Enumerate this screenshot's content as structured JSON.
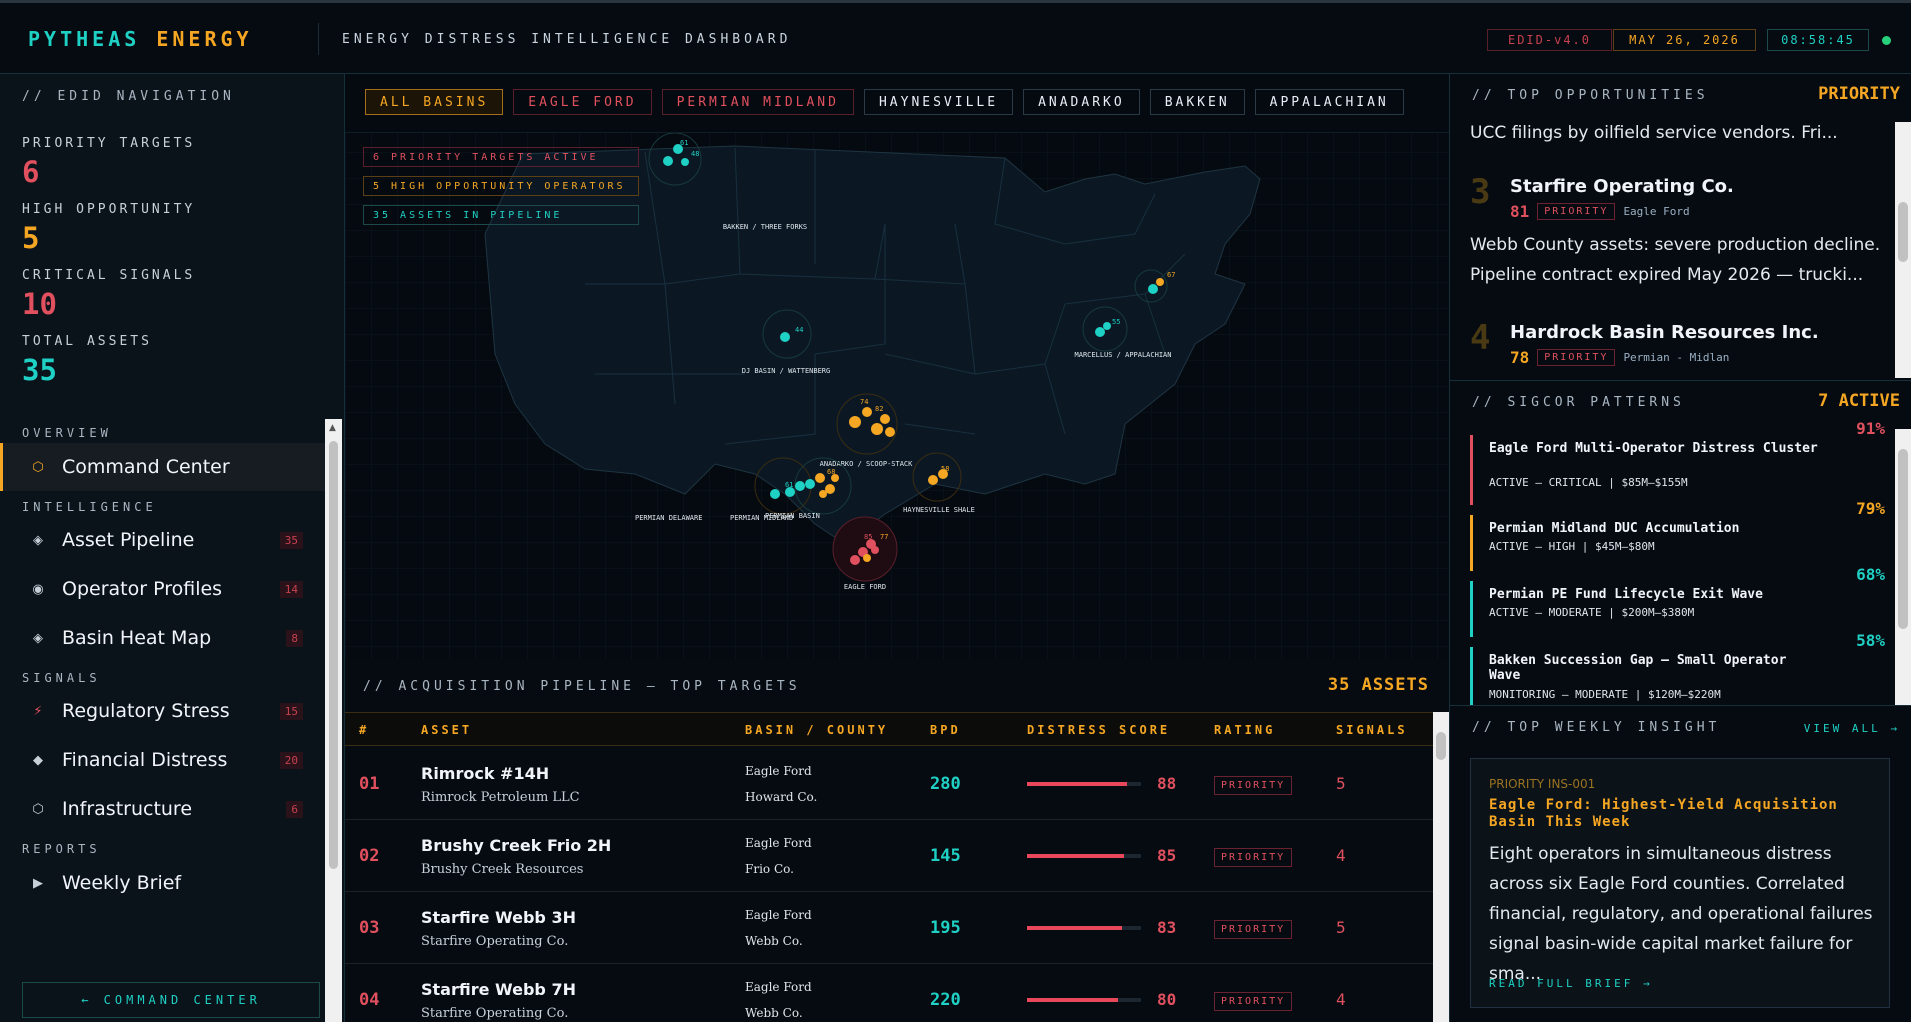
{
  "header": {
    "brand_a": "PYTHEAS",
    "brand_b": "ENERGY",
    "subtitle": "ENERGY DISTRESS INTELLIGENCE DASHBOARD",
    "version": "EDID-v4.0",
    "date": "MAY 26, 2026",
    "clock": "08:58:45"
  },
  "sidebar": {
    "title": "// EDID NAVIGATION",
    "stats": [
      {
        "label": "PRIORITY TARGETS",
        "value": "6",
        "color": "#e0505e"
      },
      {
        "label": "HIGH OPPORTUNITY",
        "value": "5",
        "color": "#f5a623"
      },
      {
        "label": "CRITICAL SIGNALS",
        "value": "10",
        "color": "#e0505e"
      },
      {
        "label": "TOTAL ASSETS",
        "value": "35",
        "color": "#1fd0c4"
      }
    ],
    "sections": {
      "overview": "OVERVIEW",
      "intelligence": "INTELLIGENCE",
      "signals": "SIGNALS",
      "reports": "REPORTS"
    },
    "items": [
      {
        "label": "Command Center",
        "icon": "hexagon-icon",
        "glyph": "⬡",
        "badge": ""
      },
      {
        "label": "Asset Pipeline",
        "icon": "diamond-icon",
        "glyph": "◈",
        "badge": "35"
      },
      {
        "label": "Operator Profiles",
        "icon": "target-icon",
        "glyph": "◉",
        "badge": "14"
      },
      {
        "label": "Basin Heat Map",
        "icon": "diamond-icon",
        "glyph": "◈",
        "badge": "8"
      },
      {
        "label": "Regulatory Stress",
        "icon": "bolt-icon",
        "glyph": "⚡",
        "badge": "15"
      },
      {
        "label": "Financial Distress",
        "icon": "diamond-solid-icon",
        "glyph": "◆",
        "badge": "20"
      },
      {
        "label": "Infrastructure",
        "icon": "hexagon-icon",
        "glyph": "⬡",
        "badge": "6"
      },
      {
        "label": "Weekly Brief",
        "icon": "play-icon",
        "glyph": "▶",
        "badge": ""
      }
    ],
    "back_button": "← COMMAND CENTER"
  },
  "map": {
    "tabs": [
      "ALL BASINS",
      "EAGLE FORD",
      "PERMIAN MIDLAND",
      "HAYNESVILLE",
      "ANADARKO",
      "BAKKEN",
      "APPALACHIAN"
    ],
    "alerts": [
      {
        "text": "6 PRIORITY TARGETS ACTIVE",
        "color": "#e0505e",
        "border": "#5a1f2a"
      },
      {
        "text": "5 HIGH OPPORTUNITY OPERATORS",
        "color": "#f5a623",
        "border": "#5c3f14"
      },
      {
        "text": "35 ASSETS IN PIPELINE",
        "color": "#1fd0c4",
        "border": "#1c4a49"
      }
    ],
    "basin_labels": [
      "BAKKEN / THREE FORKS",
      "DJ BASIN / WATTENBERG",
      "MARCELLUS / APPALACHIAN",
      "ANADARKO / SCOOP-STACK",
      "PERMIAN DELAWARE",
      "PERMIAN MIDLAND",
      "PERMIAN BASIN",
      "HAYNESVILLE SHALE",
      "EAGLE FORD"
    ]
  },
  "pipeline": {
    "title": "// ACQUISITION PIPELINE — TOP TARGETS",
    "count": "35 ASSETS",
    "columns": [
      "#",
      "ASSET",
      "BASIN / COUNTY",
      "BPD",
      "DISTRESS SCORE",
      "RATING",
      "SIGNALS"
    ],
    "rows": [
      {
        "num": "01",
        "asset": "Rimrock #14H",
        "operator": "Rimrock Petroleum LLC",
        "basin": "Eagle Ford",
        "county": "Howard Co.",
        "bpd": "280",
        "score": "88",
        "score_pct": 88,
        "rating": "PRIORITY",
        "signals": "5"
      },
      {
        "num": "02",
        "asset": "Brushy Creek Frio 2H",
        "operator": "Brushy Creek Resources",
        "basin": "Eagle Ford",
        "county": "Frio Co.",
        "bpd": "145",
        "score": "85",
        "score_pct": 85,
        "rating": "PRIORITY",
        "signals": "4"
      },
      {
        "num": "03",
        "asset": "Starfire Webb 3H",
        "operator": "Starfire Operating Co.",
        "basin": "Eagle Ford",
        "county": "Webb Co.",
        "bpd": "195",
        "score": "83",
        "score_pct": 83,
        "rating": "PRIORITY",
        "signals": "5"
      },
      {
        "num": "04",
        "asset": "Starfire Webb 7H",
        "operator": "Starfire Operating Co.",
        "basin": "Eagle Ford",
        "county": "Webb Co.",
        "bpd": "220",
        "score": "80",
        "score_pct": 80,
        "rating": "PRIORITY",
        "signals": "4"
      }
    ]
  },
  "opportunities": {
    "title": "// TOP OPPORTUNITIES",
    "badge": "PRIORITY",
    "prev_text": "UCC filings by oilfield service vendors. Fri...",
    "items": [
      {
        "rank": "3",
        "name": "Starfire Operating Co.",
        "score": "81",
        "tag": "PRIORITY",
        "basin": "Eagle Ford",
        "desc": "Webb County assets: severe production decline. Pipeline contract expired May 2026 — trucki..."
      },
      {
        "rank": "4",
        "name": "Hardrock Basin Resources Inc.",
        "score": "78",
        "tag": "PRIORITY",
        "basin": "Permian - Midlan",
        "desc": ""
      }
    ]
  },
  "patterns": {
    "title": "// SIGCOR PATTERNS",
    "badge": "7 ACTIVE",
    "items": [
      {
        "name": "Eagle Ford Multi-Operator Distress Cluster",
        "detail": "ACTIVE — CRITICAL | $85M–$155M",
        "pct": "91%",
        "color": "#e0505e"
      },
      {
        "name": "Permian Midland DUC Accumulation",
        "detail": "ACTIVE — HIGH | $45M–$80M",
        "pct": "79%",
        "color": "#f5a623"
      },
      {
        "name": "Permian PE Fund Lifecycle Exit Wave",
        "detail": "ACTIVE — MODERATE | $200M–$380M",
        "pct": "68%",
        "color": "#1fd0c4"
      },
      {
        "name": "Bakken Succession Gap — Small Operator Wave",
        "detail": "MONITORING — MODERATE | $120M–$220M",
        "pct": "58%",
        "color": "#1fd0c4"
      }
    ]
  },
  "insight": {
    "title": "// TOP WEEKLY INSIGHT",
    "view_all": "VIEW ALL →",
    "tag": "PRIORITY INS-001",
    "headline": "Eagle Ford: Highest-Yield Acquisition Basin This Week",
    "body": "Eight operators in simultaneous distress across six Eagle Ford counties. Correlated financial, regulatory, and operational failures signal basin-wide capital market failure for sma...",
    "read_more": "READ FULL BRIEF →"
  }
}
